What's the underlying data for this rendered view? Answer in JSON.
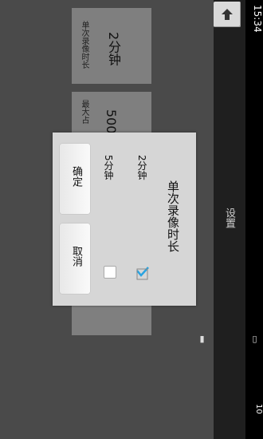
{
  "statusbar": {
    "time": "15:34",
    "battery": "10"
  },
  "actionbar": {
    "title": "设置"
  },
  "settings": {
    "item1": {
      "label": "单次录像时长",
      "value": "2分钟"
    },
    "item2": {
      "label": "最大占",
      "value": "500"
    }
  },
  "dialog": {
    "title": "单次录像时长",
    "options": [
      {
        "label": "2分钟",
        "checked": true
      },
      {
        "label": "5分钟",
        "checked": false
      }
    ],
    "confirm_label": "确定",
    "cancel_label": "取消"
  },
  "colors": {
    "accent": "#2aa3e0"
  },
  "icons": {
    "back": "up-arrow-icon",
    "status": [
      "vibrate-icon",
      "alarm-icon",
      "wifi-icon",
      "signal-icon"
    ]
  }
}
